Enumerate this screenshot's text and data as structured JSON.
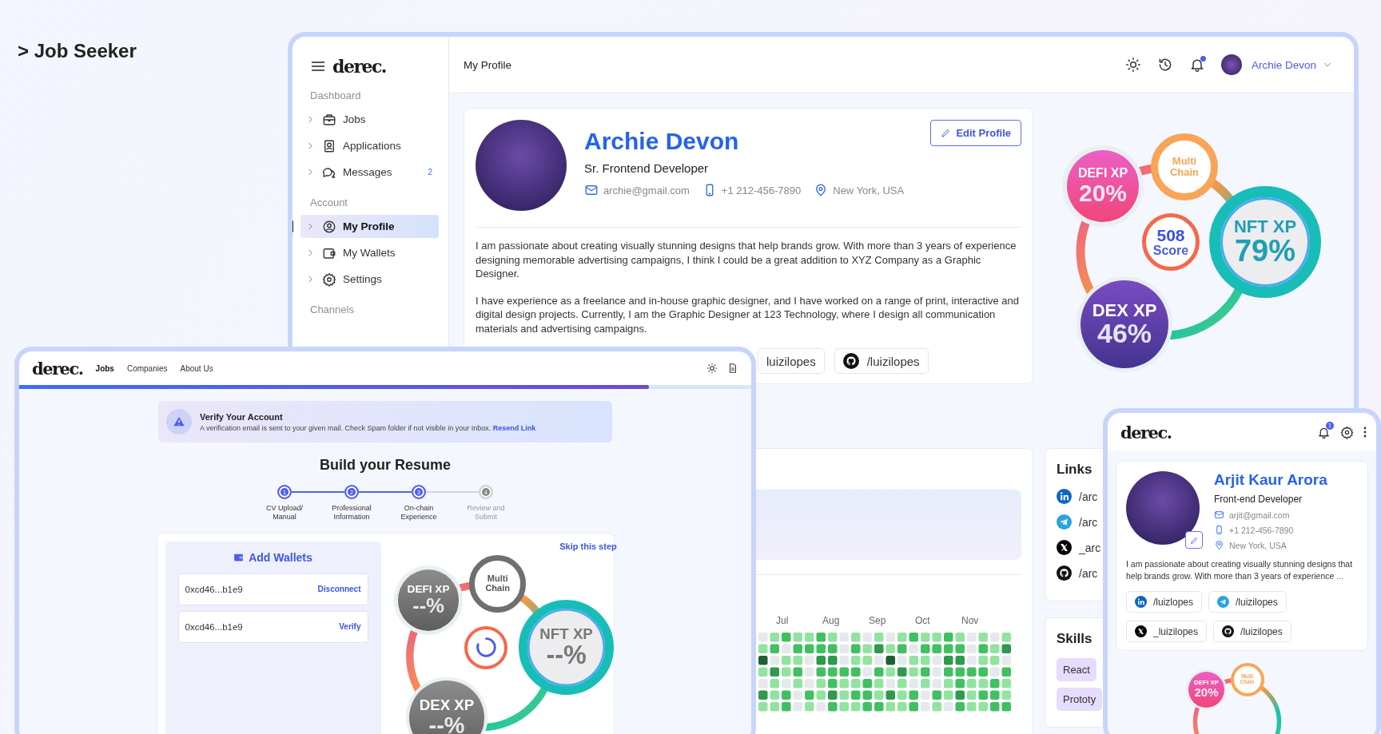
{
  "page_title": "> Job Seeker",
  "main_window": {
    "sidebar": {
      "logo": "derec.",
      "sections": [
        {
          "title": "Dashboard",
          "items": [
            {
              "label": "Jobs",
              "selected": false
            },
            {
              "label": "Applications",
              "selected": false
            },
            {
              "label": "Messages",
              "count": "2",
              "selected": false
            }
          ]
        },
        {
          "title": "Account",
          "items": [
            {
              "label": "My Profile",
              "selected": true
            },
            {
              "label": "My Wallets",
              "selected": false
            },
            {
              "label": "Settings",
              "selected": false
            }
          ]
        },
        {
          "title": "Channels"
        }
      ]
    },
    "header": {
      "title": "My Profile",
      "has_notifications": true,
      "user_name": "Archie Devon"
    },
    "profile": {
      "name": "Archie Devon",
      "role": "Sr. Frontend Developer",
      "edit_button": "Edit Profile",
      "email": "archie@gmail.com",
      "phone": "+1 212-456-7890",
      "location": "New York, USA",
      "bio": [
        "I am passionate about creating visually stunning designs that help brands grow. With more than 3 years of experience designing memorable advertising campaigns, I think I could be a great addition to XYZ Company as a Graphic Designer.",
        "I have experience as a freelance and in-house graphic designer, and I have worked on a range of print, interactive and digital design projects. Currently, I am the Graphic Designer at 123 Technology, where I design all communication materials and advertising campaigns."
      ],
      "links": [
        {
          "kind": "cut",
          "text": "luizilopes"
        },
        {
          "kind": "github",
          "text": "/luizilopes"
        }
      ]
    },
    "xp_graphic": {
      "muted": false,
      "bubbles": [
        {
          "kind": "defi",
          "label": "DEFI XP",
          "value": "20%"
        },
        {
          "kind": "multi",
          "label": "Multi Chain"
        },
        {
          "kind": "score",
          "label": "Score",
          "value": "508"
        },
        {
          "kind": "nft",
          "label": "NFT XP",
          "value": "79%"
        },
        {
          "kind": "dex",
          "label": "DEX XP",
          "value": "46%"
        }
      ]
    },
    "activity": {
      "months": [
        "Jul",
        "Aug",
        "Sep",
        "Oct",
        "Nov"
      ]
    },
    "links": {
      "title": "Links",
      "items": [
        {
          "kind": "linkedin",
          "text": "/arc"
        },
        {
          "kind": "telegram",
          "text": "/arc"
        },
        {
          "kind": "x",
          "text": "_arc"
        },
        {
          "kind": "github",
          "text": "/arc"
        }
      ]
    },
    "skills": {
      "title": "Skills",
      "items": [
        "React",
        "Prototy"
      ]
    }
  },
  "builder_window": {
    "logo": "derec.",
    "nav": [
      {
        "label": "Jobs",
        "selected": true
      },
      {
        "label": "Companies",
        "selected": false
      },
      {
        "label": "About Us",
        "selected": false
      }
    ],
    "progress": {
      "level": 0.86
    },
    "banner": {
      "title": "Verify Your Account",
      "text": "A verification email is sent to your given mail. Check Spam folder if not visible in your Inbox.",
      "link": "Resend Link"
    },
    "heading": "Build your Resume",
    "steps": [
      {
        "number": "1",
        "label": "CV Upload/ Manual",
        "done": true
      },
      {
        "number": "2",
        "label": "Professional Information",
        "done": true
      },
      {
        "number": "3",
        "label": "On-chain Experience",
        "done": true
      },
      {
        "number": "4",
        "label": "Review and Submit",
        "done": false
      }
    ],
    "wallets": {
      "title": "Add Wallets",
      "items": [
        {
          "address": "0xcd46...b1e9",
          "action": "Disconnect"
        },
        {
          "address": "0xcd46...b1e9",
          "action": "Verify"
        }
      ]
    },
    "skip_link": "Skip this step",
    "xp_graphic": {
      "muted": true,
      "bubbles": [
        {
          "kind": "defi",
          "label": "DEFI XP",
          "value": "--%"
        },
        {
          "kind": "multi",
          "label": "Multi Chain"
        },
        {
          "kind": "spinner"
        },
        {
          "kind": "nft",
          "label": "NFT XP",
          "value": "--%"
        },
        {
          "kind": "dex",
          "label": "DEX XP",
          "value": "--%"
        }
      ]
    }
  },
  "mobile_window": {
    "logo": "derec.",
    "notification_badge": "1",
    "profile": {
      "name": "Arjit Kaur Arora",
      "role": "Front-end Developer",
      "email": "arjit@gmail.com",
      "phone": "+1 212-456-7890",
      "location": "New York, USA",
      "bio": "I am passionate about creating visually stunning designs that help brands grow. With more than 3 years of experience",
      "more_link": "...",
      "links": [
        {
          "kind": "linkedin",
          "text": "/luizlopes"
        },
        {
          "kind": "telegram",
          "text": "/luizilopes"
        },
        {
          "kind": "x",
          "text": "_luizilopes"
        },
        {
          "kind": "github",
          "text": "/luizilopes"
        }
      ]
    },
    "xp_graphic": {
      "muted": false,
      "bubbles": [
        {
          "kind": "defi",
          "label": "DEFI XP",
          "value": "20%"
        },
        {
          "kind": "multi",
          "label": "Multi Chain"
        }
      ]
    }
  }
}
